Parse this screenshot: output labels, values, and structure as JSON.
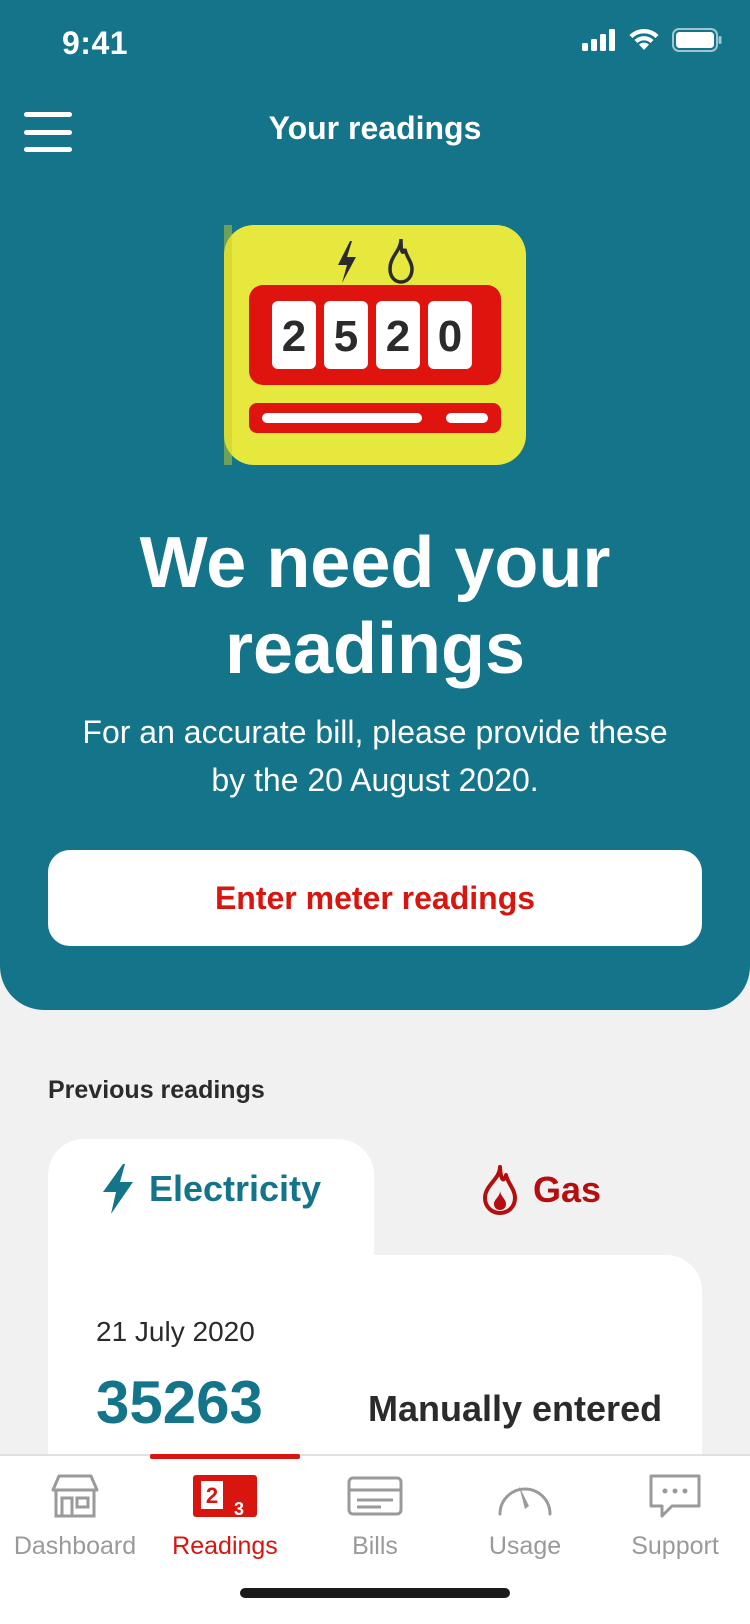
{
  "status_bar": {
    "time": "9:41"
  },
  "header": {
    "title": "Your readings"
  },
  "hero": {
    "meter_digits": [
      "2",
      "5",
      "2",
      "0"
    ],
    "heading": "We need your readings",
    "subtext": "For an accurate bill, please provide these by the 20 August 2020.",
    "cta_label": "Enter meter readings"
  },
  "previous_readings": {
    "label": "Previous readings",
    "tabs": [
      {
        "label": "Electricity",
        "icon": "lightning-icon",
        "active": true
      },
      {
        "label": "Gas",
        "icon": "flame-icon",
        "active": false
      }
    ],
    "latest": {
      "date": "21 July 2020",
      "value": "35263",
      "method": "Manually entered"
    }
  },
  "bottom_nav": {
    "items": [
      {
        "label": "Dashboard",
        "icon": "house-icon"
      },
      {
        "label": "Readings",
        "icon": "readings-icon",
        "active": true
      },
      {
        "label": "Bills",
        "icon": "bill-icon"
      },
      {
        "label": "Usage",
        "icon": "gauge-icon"
      },
      {
        "label": "Support",
        "icon": "chat-icon"
      }
    ],
    "readings_icon_digits": [
      "2",
      "3"
    ]
  },
  "colors": {
    "primary": "#13748a",
    "accent_red": "#d8150f",
    "meter_yellow": "#e6e83d",
    "background": "#f1f1f1"
  }
}
